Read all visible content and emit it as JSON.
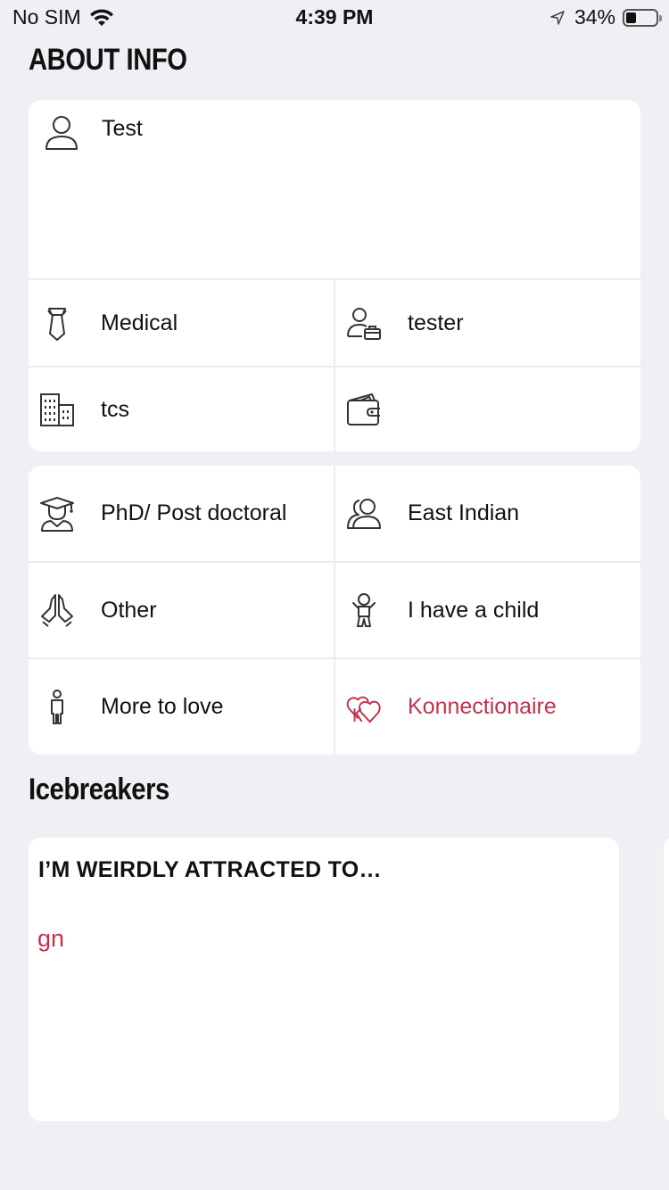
{
  "status_bar": {
    "carrier": "No SIM",
    "time": "4:39 PM",
    "battery": "34%",
    "battery_level": 0.34
  },
  "about": {
    "title": "ABOUT INFO",
    "bio": "Test",
    "profession": "Medical",
    "job_title": "tester",
    "company": "tcs",
    "income": "",
    "education": "PhD/ Post doctoral",
    "ethnicity": "East Indian",
    "religion": "Other",
    "children": "I have a child",
    "body_type": "More to love",
    "membership": "Konnectionaire"
  },
  "icebreakers": {
    "title": "Icebreakers",
    "cards": [
      {
        "question": "I’M WEIRDLY ATTRACTED TO…",
        "answer": "gn"
      }
    ]
  },
  "colors": {
    "accent": "#c0324b",
    "background": "#efeff4",
    "card": "#ffffff"
  },
  "icons": {
    "bio": "person-icon",
    "profession": "tie-icon",
    "job_title": "person-briefcase-icon",
    "company": "building-icon",
    "income": "wallet-icon",
    "education": "graduate-icon",
    "ethnicity": "people-icon",
    "religion": "praying-hands-icon",
    "children": "baby-icon",
    "body_type": "body-icon",
    "membership": "hearts-k-icon"
  }
}
